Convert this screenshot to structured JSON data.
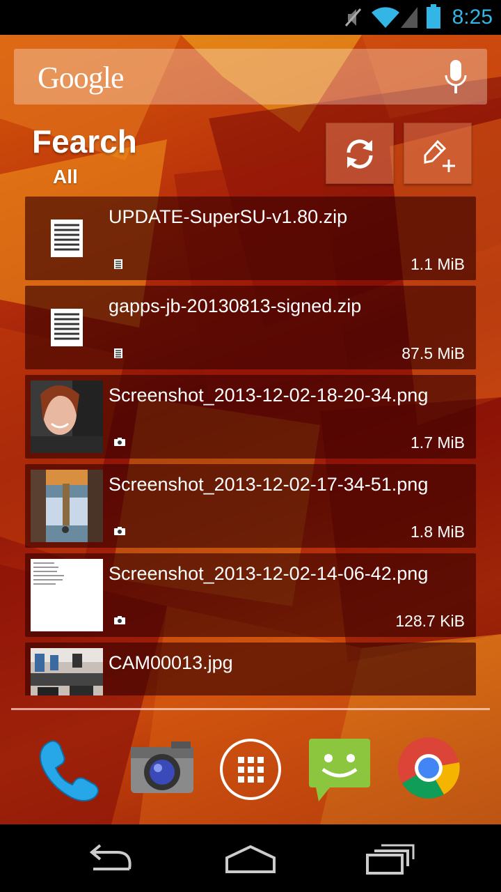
{
  "status_bar": {
    "time": "8:25",
    "icons": [
      "mute-icon",
      "wifi-icon",
      "signal-icon",
      "battery-icon"
    ]
  },
  "search": {
    "logo_text": "Google",
    "voice_icon": "mic-icon"
  },
  "widget": {
    "title": "Fearch",
    "filter": "All",
    "buttons": [
      "refresh-icon",
      "new-note-icon"
    ]
  },
  "files": [
    {
      "name": "UPDATE-SuperSU-v1.80.zip",
      "size": "1.1 MiB",
      "type": "document",
      "thumb": "document-icon"
    },
    {
      "name": "gapps-jb-20130813-signed.zip",
      "size": "87.5 MiB",
      "type": "document",
      "thumb": "document-icon"
    },
    {
      "name": "Screenshot_2013-12-02-18-20-34.png",
      "size": "1.7 MiB",
      "type": "image",
      "thumb": "photo-selfie"
    },
    {
      "name": "Screenshot_2013-12-02-17-34-51.png",
      "size": "1.8 MiB",
      "type": "image",
      "thumb": "photo-game"
    },
    {
      "name": "Screenshot_2013-12-02-14-06-42.png",
      "size": "128.7 KiB",
      "type": "image",
      "thumb": "photo-text"
    },
    {
      "name": "CAM00013.jpg",
      "size": "",
      "type": "image",
      "thumb": "photo-office"
    }
  ],
  "dock": [
    "phone-icon",
    "camera-icon",
    "app-drawer-icon",
    "messaging-icon",
    "chrome-icon"
  ],
  "nav": [
    "back-icon",
    "home-icon",
    "recents-icon"
  ],
  "colors": {
    "clock": "#33b5e5",
    "wallpaper_primary": "#b8300a",
    "row_background": "#370000"
  }
}
